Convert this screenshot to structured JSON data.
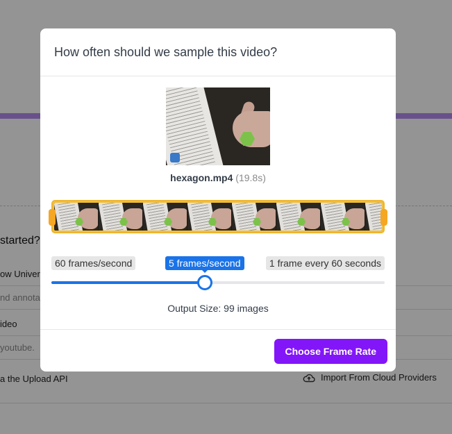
{
  "background": {
    "heading": "started?",
    "row1": "ow Univers",
    "row2": "nd annota",
    "row3": "ideo",
    "row4": "youtube.",
    "row5": "a the Upload API",
    "cloud_import": "Import From Cloud Providers",
    "cloud_icon": "cloud-upload-icon"
  },
  "modal": {
    "title": "How often should we sample this video?",
    "video": {
      "filename": "hexagon.mp4",
      "duration": "(19.8s)"
    },
    "filmstrip": {
      "frame_count": 8
    },
    "slider": {
      "min_label": "60 frames/second",
      "current_label": "5 frames/second",
      "max_label": "1 frame every 60 seconds",
      "position_fraction": 0.46
    },
    "output_size": "Output Size: 99 images",
    "submit_label": "Choose Frame Rate"
  },
  "colors": {
    "accent": "#8315f9",
    "slider": "#1a73e8",
    "filmstrip_border": "#f0b429"
  }
}
